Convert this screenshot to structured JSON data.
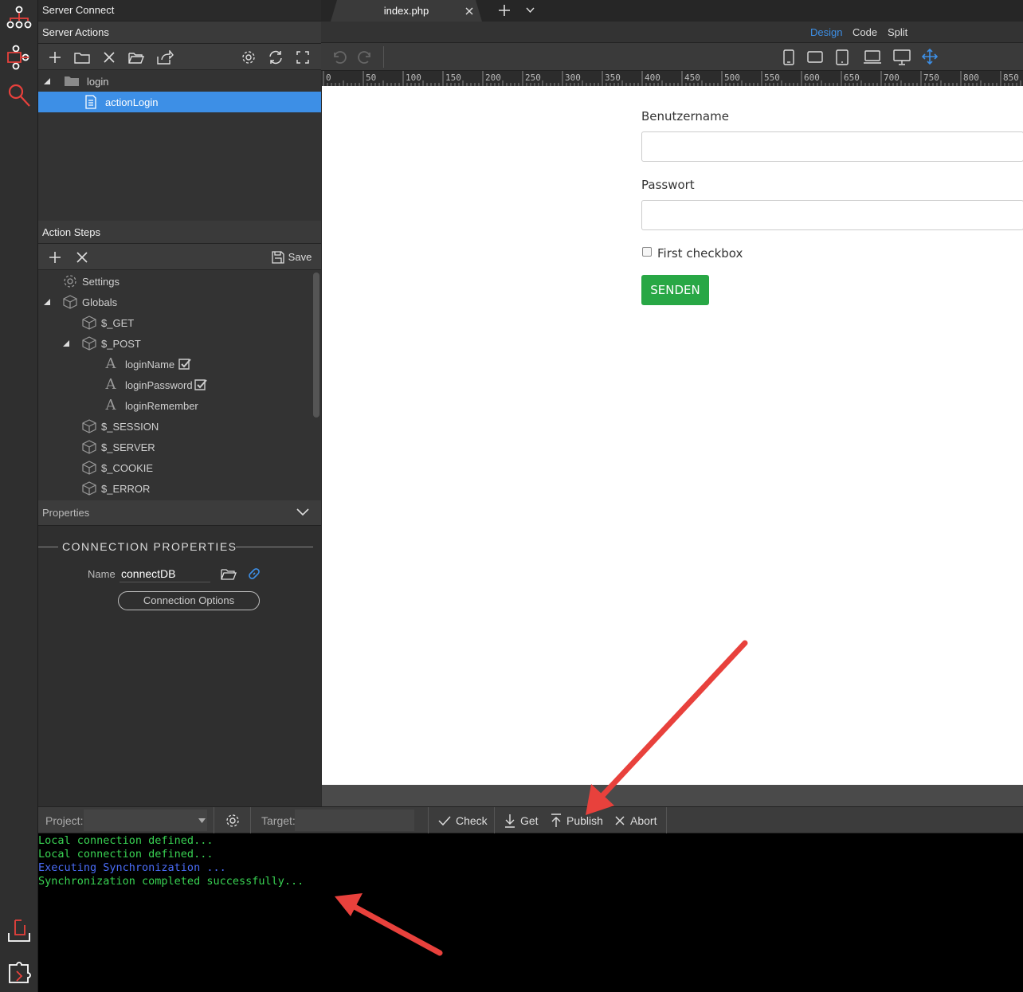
{
  "app": {
    "title": "Server Connect"
  },
  "server_actions": {
    "header": "Server Actions",
    "tree": [
      {
        "label": "login"
      },
      {
        "label": "actionLogin"
      }
    ]
  },
  "action_steps": {
    "header": "Action Steps",
    "save_label": "Save",
    "tree": [
      {
        "label": "Settings"
      },
      {
        "label": "Globals"
      },
      {
        "label": "$_GET"
      },
      {
        "label": "$_POST"
      },
      {
        "label": "loginName"
      },
      {
        "label": "loginPassword"
      },
      {
        "label": "loginRemember"
      },
      {
        "label": "$_SESSION"
      },
      {
        "label": "$_SERVER"
      },
      {
        "label": "$_COOKIE"
      },
      {
        "label": "$_ERROR"
      }
    ]
  },
  "properties": {
    "header": "Properties",
    "section": "CONNECTION PROPERTIES",
    "name_label": "Name",
    "name_value": "connectDB",
    "options_button": "Connection Options"
  },
  "tabs": {
    "file": "index.php"
  },
  "views": {
    "design": "Design",
    "code": "Code",
    "split": "Split",
    "active": "Design"
  },
  "ruler": [
    "0",
    "50",
    "100",
    "150",
    "200",
    "250",
    "300",
    "350",
    "400",
    "450",
    "500",
    "550",
    "600",
    "650",
    "700",
    "750",
    "800",
    "850"
  ],
  "form": {
    "username_label": "Benutzername",
    "password_label": "Passwort",
    "checkbox_label": "First checkbox",
    "submit_label": "SENDEN"
  },
  "sync": {
    "project_label": "Project:",
    "target_label": "Target:",
    "check": "Check",
    "get": "Get",
    "publish": "Publish",
    "abort": "Abort"
  },
  "console": [
    {
      "text": "Local connection defined...",
      "color": "#39d353"
    },
    {
      "text": "Local connection defined...",
      "color": "#39d353"
    },
    {
      "text": "Executing Synchronization ...",
      "color": "#4a6cf7"
    },
    {
      "text": "Synchronization completed successfully...",
      "color": "#39d353"
    }
  ],
  "colors": {
    "accent": "#3d8fe6",
    "success": "#28a745",
    "arrow": "#e8413c"
  }
}
